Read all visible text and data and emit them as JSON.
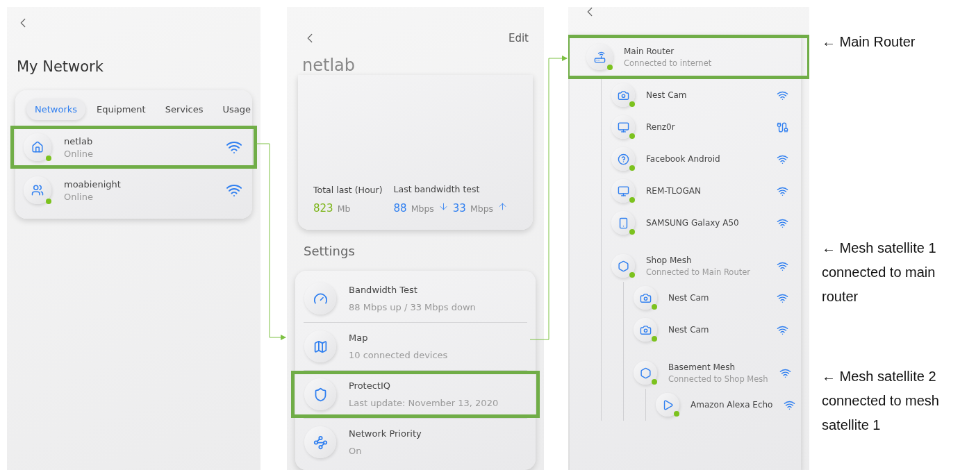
{
  "network_list_screen": {
    "title": "My Network",
    "tabs": [
      {
        "label": "Networks",
        "selected": true
      },
      {
        "label": "Equipment",
        "selected": false
      },
      {
        "label": "Services",
        "selected": false
      },
      {
        "label": "Usage",
        "selected": false
      }
    ],
    "networks": [
      {
        "name": "netlab",
        "status": "Online",
        "kind": "home",
        "online": true,
        "highlighted": true
      },
      {
        "name": "moabienight",
        "status": "Online",
        "kind": "people",
        "online": true,
        "highlighted": false
      }
    ]
  },
  "network_detail_screen": {
    "edit_label": "Edit",
    "title": "netlab",
    "usage": [
      {
        "label": "Total last (Hour)",
        "readings": [
          {
            "value": "823",
            "unit": "Mb",
            "color": "#7cb518"
          }
        ]
      },
      {
        "label": "Last bandwidth test",
        "readings": [
          {
            "value": "88",
            "unit": "Mbps",
            "downward": true,
            "color": "#2f7ff0"
          },
          {
            "value": "33",
            "unit": "Mbps",
            "downward": false,
            "color": "#2f7ff0"
          }
        ]
      }
    ],
    "settings_heading": "Settings",
    "settings": [
      {
        "kind": "gauge",
        "title": "Bandwidth Test",
        "subtitle": "88 Mbps up / 33 Mbps down",
        "highlighted": false
      },
      {
        "kind": "map",
        "title": "Map",
        "subtitle": "10 connected devices",
        "highlighted": false
      },
      {
        "kind": "shield",
        "title": "ProtectIQ",
        "subtitle": "Last update: November 13, 2020",
        "highlighted": true
      },
      {
        "kind": "priority",
        "title": "Network Priority",
        "subtitle": "On",
        "highlighted": false
      }
    ]
  },
  "device_map_screen": {
    "devices": [
      {
        "name": "Main Router",
        "subtitle": "Connected to internet",
        "kind": "router",
        "online": true,
        "highlighted": true,
        "children": [
          {
            "name": "Nest Cam",
            "kind": "camera",
            "wired": false,
            "online": true
          },
          {
            "name": "Renz0r",
            "kind": "computer",
            "wired": true,
            "online": true
          },
          {
            "name": "Facebook Android",
            "kind": "unknown",
            "wired": false,
            "online": true
          },
          {
            "name": "REM-TLOGAN",
            "kind": "computer",
            "wired": false,
            "online": true
          },
          {
            "name": "SAMSUNG Galaxy A50",
            "kind": "phone",
            "wired": false,
            "online": true
          },
          {
            "name": "Shop Mesh",
            "subtitle": "Connected to Main Router",
            "kind": "mesh",
            "wired": false,
            "online": true,
            "children": [
              {
                "name": "Nest Cam",
                "kind": "camera",
                "wired": false,
                "online": true
              },
              {
                "name": "Nest Cam",
                "kind": "camera",
                "wired": false,
                "online": true
              },
              {
                "name": "Basement Mesh",
                "subtitle": "Connected to Shop Mesh",
                "kind": "mesh",
                "wired": false,
                "online": true,
                "children": [
                  {
                    "name": "Amazon Alexa Echo",
                    "kind": "media",
                    "wired": false,
                    "online": true
                  }
                ]
              }
            ]
          }
        ]
      }
    ]
  },
  "annotations": [
    "← Main Router",
    "← Mesh satellite 1 connected to main router",
    "← Mesh satellite 2 connected to mesh satellite 1"
  ]
}
